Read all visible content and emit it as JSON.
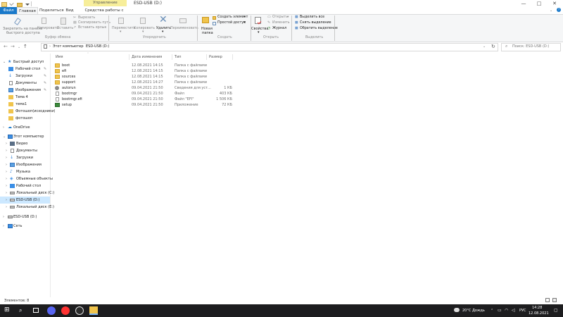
{
  "window": {
    "context_tab_label": "Управление",
    "title": "ESD-USB (D:)",
    "controls": [
      "—",
      "□",
      "✕"
    ]
  },
  "tabs": [
    {
      "label": "Файл"
    },
    {
      "label": "Главная"
    },
    {
      "label": "Поделиться"
    },
    {
      "label": "Вид"
    },
    {
      "label": "Средства работы с дисками"
    }
  ],
  "ribbon": {
    "clipboard": {
      "pin_label_1": "Закрепить на панели",
      "pin_label_2": "быстрого доступа",
      "copy_label": "Копировать",
      "paste_label": "Вставить",
      "cut_label": "Вырезать",
      "copy_path_label": "Скопировать путь",
      "paste_shortcut_label": "Вставить ярлык",
      "group_name": "Буфер обмена"
    },
    "organize": {
      "move_label": "Переместить",
      "copy_to_label": "Копировать",
      "delete_label": "Удалить",
      "rename_label": "Переименовать",
      "group_name": "Упорядочить"
    },
    "create": {
      "new_folder_1": "Новая",
      "new_folder_2": "папка",
      "new_item_label": "Создать элемент",
      "easy_access_label": "Простой доступ",
      "group_name": "Создать"
    },
    "open": {
      "properties_label": "Свойства",
      "open_label": "Открыть",
      "edit_label": "Изменить",
      "history_label": "Журнал",
      "group_name": "Открыть"
    },
    "select": {
      "select_all_label": "Выделить все",
      "select_none_label": "Снять выделение",
      "invert_label": "Обратить выделение",
      "group_name": "Выделить"
    }
  },
  "address": {
    "path": [
      "Этот компьютер",
      "ESD-USB (D:)"
    ],
    "search_placeholder": "Поиск: ESD-USB (D:)"
  },
  "nav": {
    "quick_access": "Быстрый доступ",
    "qa_items": [
      "Рабочий стол",
      "Загрузки",
      "Документы",
      "Изображения",
      "Тема 4",
      "тема1",
      "Фотошоп(исходники)",
      "фотошоп"
    ],
    "onedrive": "OneDrive",
    "this_pc": "Этот компьютер",
    "pc_items": [
      "Видео",
      "Документы",
      "Загрузки",
      "Изображения",
      "Музыка",
      "Объемные объекты",
      "Рабочий стол",
      "Локальный диск (C:)",
      "ESD-USB (D:)",
      "Локальный диск (E:)"
    ],
    "usb": "ESD-USB (D:)",
    "network": "Сеть"
  },
  "columns": {
    "name": "Имя",
    "date": "Дата изменения",
    "type": "Тип",
    "size": "Размер"
  },
  "files": [
    {
      "name": "boot",
      "date": "12.08.2021 14:15",
      "type": "Папка с файлами",
      "size": "",
      "icon": "folder"
    },
    {
      "name": "efi",
      "date": "12.08.2021 14:15",
      "type": "Папка с файлами",
      "size": "",
      "icon": "folder"
    },
    {
      "name": "sources",
      "date": "12.08.2021 14:15",
      "type": "Папка с файлами",
      "size": "",
      "icon": "folder"
    },
    {
      "name": "support",
      "date": "12.08.2021 14:27",
      "type": "Папка с файлами",
      "size": "",
      "icon": "folder"
    },
    {
      "name": "autorun",
      "date": "09.04.2021 21:50",
      "type": "Сведения для уст...",
      "size": "1 КБ",
      "icon": "gear"
    },
    {
      "name": "bootmgr",
      "date": "09.04.2021 21:50",
      "type": "Файл",
      "size": "403 КБ",
      "icon": "file"
    },
    {
      "name": "bootmgr.efi",
      "date": "09.04.2021 21:50",
      "type": "Файл \"EFI\"",
      "size": "1 506 КБ",
      "icon": "file"
    },
    {
      "name": "setup",
      "date": "09.04.2021 21:50",
      "type": "Приложение",
      "size": "72 КБ",
      "icon": "setup"
    }
  ],
  "status": {
    "items_count": "Элементов: 8"
  },
  "taskbar": {
    "weather": "20°C  Дождь",
    "lang": "РУС",
    "time": "14:28",
    "date": "12.08.2021"
  },
  "colors": {
    "accent": "#1979ca",
    "selection": "#cce8ff",
    "taskbar": "#1d1d1f"
  }
}
